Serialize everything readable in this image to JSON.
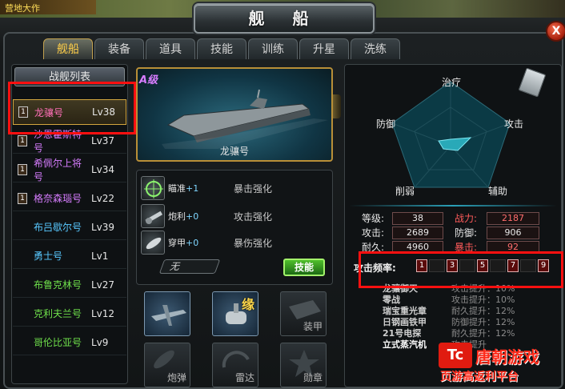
{
  "window": {
    "title": "舰 船",
    "close_label": "X",
    "top_left_text": "营地大作"
  },
  "tabs": [
    "舰船",
    "装备",
    "道具",
    "技能",
    "训练",
    "升星",
    "洗练"
  ],
  "active_tab": "舰船",
  "ship_list": {
    "title": "战舰列表",
    "items": [
      {
        "badge": "1",
        "name": "龙骧号",
        "level": "Lv38",
        "color": "#ff6fb7",
        "selected": true
      },
      {
        "badge": "1",
        "name": "沙恩霍斯特号",
        "level": "Lv37",
        "color": "#d77dff",
        "selected": false
      },
      {
        "badge": "1",
        "name": "希佩尔上将号",
        "level": "Lv34",
        "color": "#d77dff",
        "selected": false
      },
      {
        "badge": "1",
        "name": "格奈森瑙号",
        "level": "Lv22",
        "color": "#d77dff",
        "selected": false
      },
      {
        "badge": "",
        "name": "布吕歇尔号",
        "level": "Lv39",
        "color": "#58c8ff",
        "selected": false
      },
      {
        "badge": "",
        "name": "勇士号",
        "level": "Lv1",
        "color": "#58c8ff",
        "selected": false
      },
      {
        "badge": "",
        "name": "布鲁克林号",
        "level": "Lv27",
        "color": "#6fe04b",
        "selected": false
      },
      {
        "badge": "",
        "name": "克利夫兰号",
        "level": "Lv12",
        "color": "#6fe04b",
        "selected": false
      },
      {
        "badge": "",
        "name": "哥伦比亚号",
        "level": "Lv9",
        "color": "#6fe04b",
        "selected": false
      }
    ]
  },
  "ship_view": {
    "grade": "A级",
    "name": "龙骧号"
  },
  "skills": [
    {
      "name": "瞄准",
      "level": "+1",
      "effect": "暴击强化",
      "icon": "crosshair-icon"
    },
    {
      "name": "炮利",
      "level": "+0",
      "effect": "攻击强化",
      "icon": "cannon-icon"
    },
    {
      "name": "穿甲",
      "level": "+0",
      "effect": "暴伤强化",
      "icon": "shell-icon"
    }
  ],
  "skill_input": {
    "value": "无"
  },
  "skill_button": "技能",
  "equipment": {
    "slot1_label": "",
    "slot2_label": "缘",
    "slot3_label": "装甲",
    "slot4_label": "炮弹",
    "slot5_label": "雷达",
    "slot6_label": "勋章"
  },
  "radar": {
    "top": "治疗",
    "left": "防御",
    "right": "攻击",
    "bottom_left": "削弱",
    "bottom_right": "辅助"
  },
  "stats": {
    "level_label": "等级:",
    "level": "38",
    "power_label": "战力:",
    "power": "2187",
    "attack_label": "攻击:",
    "attack": "2689",
    "defense_label": "防御:",
    "defense": "906",
    "durability_label": "耐久:",
    "durability": "4960",
    "crit_label": "暴击:",
    "crit": "92"
  },
  "attack_frequency": {
    "label": "攻击频率:",
    "values": [
      "1",
      "3",
      "5",
      "7",
      "9"
    ]
  },
  "buffs": [
    {
      "name": "龙骧御天",
      "desc": "攻击提升：10%"
    },
    {
      "name": "零战",
      "desc": "攻击提升：10%"
    },
    {
      "name": "瑞宝重光章",
      "desc": "耐久提升：12%"
    },
    {
      "name": "日钢画铁甲",
      "desc": "防御提升：12%"
    },
    {
      "name": "21号电探",
      "desc": "耐久提升：12%"
    },
    {
      "name": "立式蒸汽机",
      "desc": "攻击提升"
    }
  ],
  "watermark": {
    "brand": "唐朝游戏",
    "slogan": "页游高返利平台",
    "logo_text": "Tc"
  },
  "colors": {
    "accent_gold": "#c2a150",
    "highlight_red": "#ff1010",
    "button_green": "#4fbf2c"
  }
}
